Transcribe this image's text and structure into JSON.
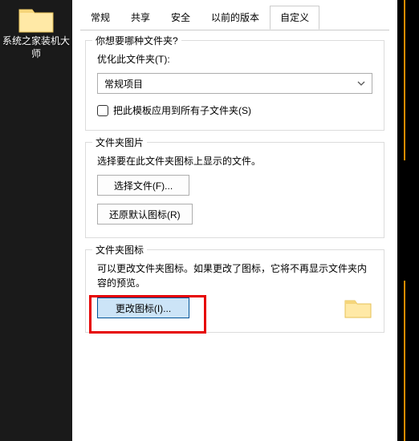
{
  "desktop": {
    "icon_label": "系统之家装机大师",
    "icon_name": "folder-icon"
  },
  "dialog": {
    "tabs": [
      {
        "label": "常规",
        "active": false
      },
      {
        "label": "共享",
        "active": false
      },
      {
        "label": "安全",
        "active": false
      },
      {
        "label": "以前的版本",
        "active": false
      },
      {
        "label": "自定义",
        "active": true
      }
    ],
    "section1": {
      "legend": "你想要哪种文件夹?",
      "optimize_label": "优化此文件夹(T):",
      "select_value": "常规项目",
      "checkbox_label": "把此模板应用到所有子文件夹(S)"
    },
    "section2": {
      "legend": "文件夹图片",
      "desc": "选择要在此文件夹图标上显示的文件。",
      "choose_btn": "选择文件(F)...",
      "restore_btn": "还原默认图标(R)"
    },
    "section3": {
      "legend": "文件夹图标",
      "desc": "可以更改文件夹图标。如果更改了图标，它将不再显示文件夹内容的预览。",
      "change_btn": "更改图标(I)...",
      "preview_icon": "folder-icon"
    }
  }
}
